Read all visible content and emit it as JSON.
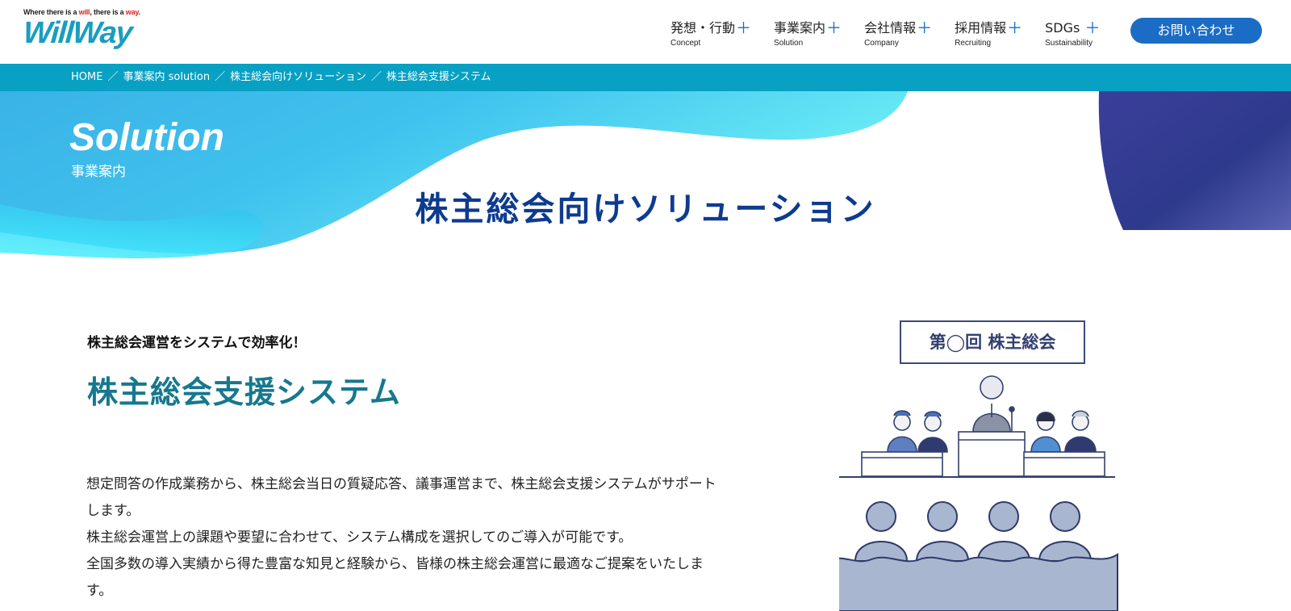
{
  "logo": {
    "tagline_part1": "Where there is a ",
    "tagline_will": "will",
    "tagline_part2": ", there is a ",
    "tagline_way": "way",
    "tagline_end": ".",
    "name": "WillWay",
    "color": "#1a9ec0"
  },
  "nav": {
    "items": [
      {
        "label": "発想・行動",
        "sub": "Concept"
      },
      {
        "label": "事業案内",
        "sub": "Solution"
      },
      {
        "label": "会社情報",
        "sub": "Company"
      },
      {
        "label": "採用情報",
        "sub": "Recruiting"
      },
      {
        "label": "SDGs",
        "sub": "Sustainability"
      }
    ],
    "expand_icon": "plus-icon",
    "contact_label": "お問い合わせ"
  },
  "breadcrumb": {
    "items": [
      "HOME",
      "事業案内 solution",
      "株主総会向けソリューション",
      "株主総会支援システム"
    ],
    "separator": "／"
  },
  "hero": {
    "section_en": "Solution",
    "section_jp": "事業案内",
    "title": "株主総会向けソリューション"
  },
  "content": {
    "eyebrow": "株主総会運営をシステムで効率化！",
    "heading": "株主総会支援システム",
    "paragraphs": [
      "想定問答の作成業務から、株主総会当日の質疑応答、議事運営まで、株主総会支援システムがサポートします。",
      "株主総会運営上の課題や要望に合わせて、システム構成を選択してのご導入が可能です。",
      "全国多数の導入実績から得た豊富な知見と経験から、皆様の株主総会運営に最適なご提案をいたします。"
    ]
  },
  "illustration": {
    "sign_text": "第◯回 株主総会"
  },
  "colors": {
    "accent": "#08a0c3",
    "title": "#0d3b8f",
    "heading": "#16788e",
    "button": "#1a6cc4"
  }
}
